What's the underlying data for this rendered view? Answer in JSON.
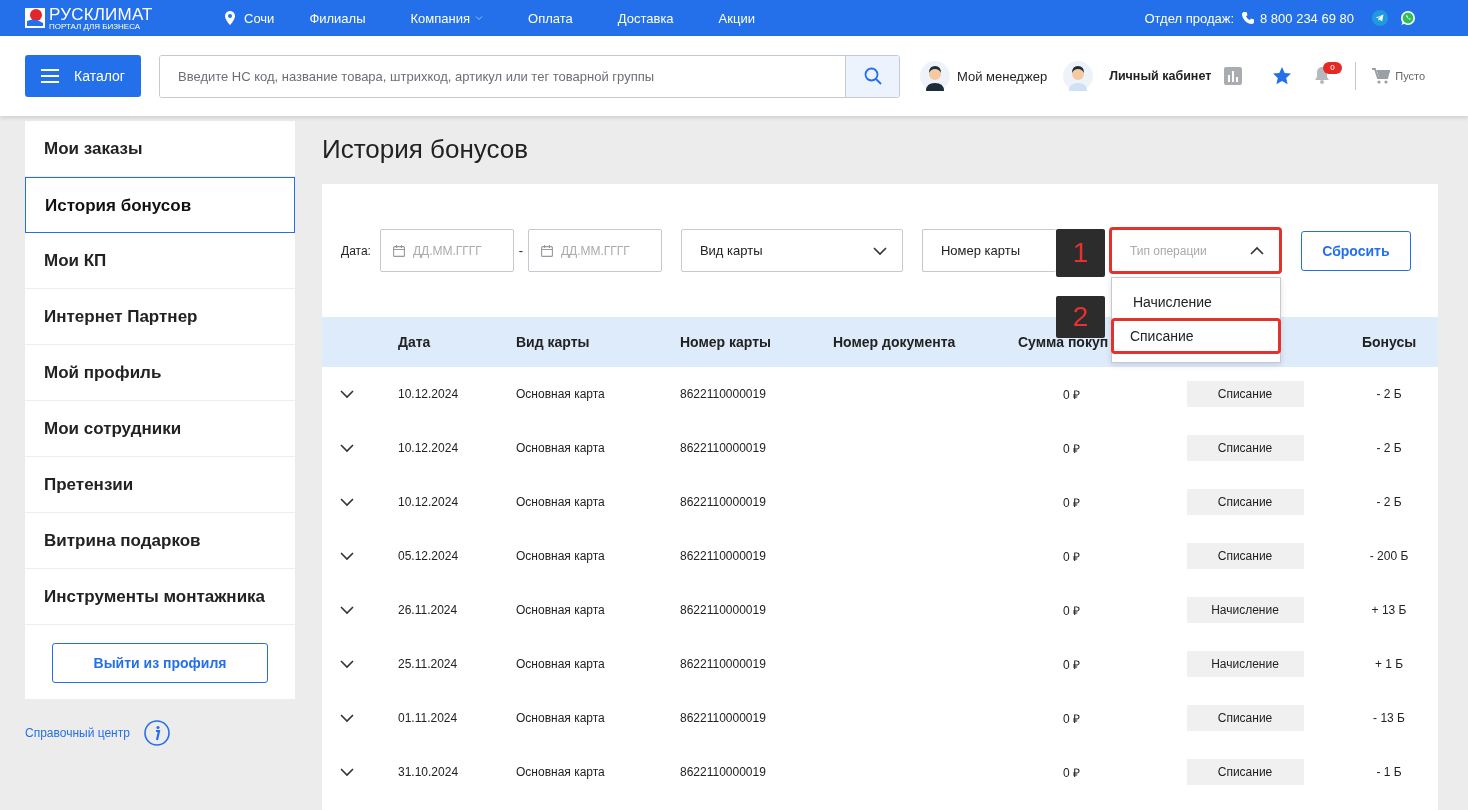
{
  "topbar": {
    "logo": {
      "name": "РУСКЛИМАТ",
      "tagline": "ПОРТАЛ ДЛЯ БИЗНЕСА"
    },
    "city": "Сочи",
    "links": [
      {
        "label": "Филиалы",
        "dropdown": false
      },
      {
        "label": "Компания",
        "dropdown": true
      },
      {
        "label": "Оплата",
        "dropdown": false
      },
      {
        "label": "Доставка",
        "dropdown": false
      },
      {
        "label": "Акции",
        "dropdown": false
      }
    ],
    "sales_label": "Отдел продаж:",
    "phone": "8 800 234 69 80"
  },
  "header": {
    "catalog_button": "Каталог",
    "search": {
      "placeholder": "Введите НС код, название товара, штрихкод, артикул или тег товарной группы"
    },
    "manager": "Мой менеджер",
    "account": "Личный кабинет",
    "notifications_count": "0",
    "cart": "Пусто"
  },
  "sidebar": {
    "items": [
      {
        "label": "Мои заказы",
        "selected": false
      },
      {
        "label": "История бонусов",
        "selected": true
      },
      {
        "label": "Мои КП",
        "selected": false
      },
      {
        "label": "Интернет Партнер",
        "selected": false
      },
      {
        "label": "Мой профиль",
        "selected": false
      },
      {
        "label": "Мои сотрудники",
        "selected": false
      },
      {
        "label": "Претензии",
        "selected": false
      },
      {
        "label": "Витрина подарков",
        "selected": false
      },
      {
        "label": "Инструменты монтажника",
        "selected": false
      }
    ],
    "logout_button": "Выйти из профиля",
    "help_link": "Справочный центр"
  },
  "page_title": "История бонусов",
  "filters": {
    "date_label": "Дата:",
    "date_from": {
      "placeholder": "ДД.ММ.ГГГГ"
    },
    "date_separator": "-",
    "date_to": {
      "placeholder": "ДД.ММ.ГГГГ"
    },
    "card_type": "Вид карты",
    "card_number": "Номер карты",
    "operation_type": {
      "placeholder": "Тип операции",
      "expanded": true,
      "highlighted": true,
      "options": [
        {
          "label": "Начисление",
          "highlighted": false
        },
        {
          "label": "Списание",
          "highlighted": true
        }
      ]
    },
    "reset_button": "Сбросить"
  },
  "annotations": [
    "1",
    "2"
  ],
  "table": {
    "columns": [
      "Дата",
      "Вид карты",
      "Номер карты",
      "Номер документа",
      "Сумма покуп",
      "Бонусы"
    ],
    "rows": [
      {
        "date": "10.12.2024",
        "card_type": "Основная карта",
        "card_number": "8622110000019",
        "sum": "0 ₽",
        "operation": "Списание",
        "bonuses": "- 2 Б"
      },
      {
        "date": "10.12.2024",
        "card_type": "Основная карта",
        "card_number": "8622110000019",
        "sum": "0 ₽",
        "operation": "Списание",
        "bonuses": "- 2 Б"
      },
      {
        "date": "10.12.2024",
        "card_type": "Основная карта",
        "card_number": "8622110000019",
        "sum": "0 ₽",
        "operation": "Списание",
        "bonuses": "- 2 Б"
      },
      {
        "date": "05.12.2024",
        "card_type": "Основная карта",
        "card_number": "8622110000019",
        "sum": "0 ₽",
        "operation": "Списание",
        "bonuses": "- 200 Б"
      },
      {
        "date": "26.11.2024",
        "card_type": "Основная карта",
        "card_number": "8622110000019",
        "sum": "0 ₽",
        "operation": "Начисление",
        "bonuses": "+ 13 Б"
      },
      {
        "date": "25.11.2024",
        "card_type": "Основная карта",
        "card_number": "8622110000019",
        "sum": "0 ₽",
        "operation": "Начисление",
        "bonuses": "+ 1 Б"
      },
      {
        "date": "01.11.2024",
        "card_type": "Основная карта",
        "card_number": "8622110000019",
        "sum": "0 ₽",
        "operation": "Списание",
        "bonuses": "- 13 Б"
      },
      {
        "date": "31.10.2024",
        "card_type": "Основная карта",
        "card_number": "8622110000019",
        "sum": "0 ₽",
        "operation": "Списание",
        "bonuses": "- 1 Б"
      }
    ]
  }
}
